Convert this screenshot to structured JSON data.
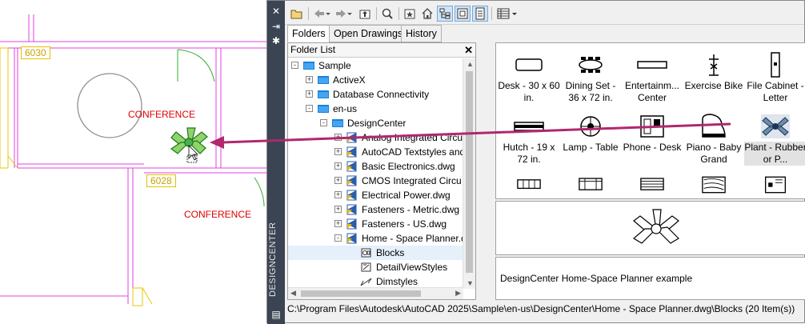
{
  "cad": {
    "rooms": [
      {
        "number": "6030",
        "label": "CONFERENCE"
      },
      {
        "number": "6028",
        "label": "CONFERENCE"
      }
    ]
  },
  "palette": {
    "title": "DESIGNCENTER",
    "strip_buttons": [
      "close-icon",
      "autohide-icon",
      "properties-icon"
    ]
  },
  "toolbar": {
    "buttons": [
      "load-icon",
      "back-icon",
      "forward-icon",
      "up-icon",
      "search-icon",
      "favorites-icon",
      "home-icon",
      "tree-toggle-icon",
      "preview-icon",
      "description-icon",
      "views-icon"
    ]
  },
  "tabs": [
    "Folders",
    "Open Drawings",
    "History"
  ],
  "folder_list": {
    "header": "Folder List",
    "items": [
      {
        "label": "Sample",
        "type": "folder"
      },
      {
        "label": "ActiveX",
        "type": "folder"
      },
      {
        "label": "Database Connectivity",
        "type": "folder"
      },
      {
        "label": "en-us",
        "type": "folder"
      },
      {
        "label": "DesignCenter",
        "type": "folder"
      },
      {
        "label": "Analog Integrated Circu",
        "type": "drawing"
      },
      {
        "label": "AutoCAD Textstyles and",
        "type": "drawing"
      },
      {
        "label": "Basic Electronics.dwg",
        "type": "drawing"
      },
      {
        "label": "CMOS Integrated Circu",
        "type": "drawing"
      },
      {
        "label": "Electrical Power.dwg",
        "type": "drawing"
      },
      {
        "label": "Fasteners - Metric.dwg",
        "type": "drawing"
      },
      {
        "label": "Fasteners - US.dwg",
        "type": "drawing"
      },
      {
        "label": "Home - Space Planner.d",
        "type": "drawing"
      },
      {
        "label": "Blocks",
        "type": "blocks"
      },
      {
        "label": "DetailViewStyles",
        "type": "styles"
      },
      {
        "label": "Dimstyles",
        "type": "dimstyles"
      }
    ]
  },
  "content": {
    "items": [
      {
        "label": "Desk - 30 x 60 in.",
        "icon": "desk-icon"
      },
      {
        "label": "Dining Set - 36 x 72 in.",
        "icon": "dining-set-icon"
      },
      {
        "label": "Entertainm... Center",
        "icon": "entertainment-center-icon"
      },
      {
        "label": "Exercise Bike",
        "icon": "exercise-bike-icon"
      },
      {
        "label": "File Cabinet - Letter",
        "icon": "file-cabinet-icon"
      },
      {
        "label": "Hutch - 19 x 72 in.",
        "icon": "hutch-icon"
      },
      {
        "label": "Lamp - Table",
        "icon": "lamp-icon"
      },
      {
        "label": "Phone - Desk",
        "icon": "phone-icon"
      },
      {
        "label": "Piano - Baby Grand",
        "icon": "piano-icon"
      },
      {
        "label": "Plant - Rubber or P...",
        "icon": "plant-icon",
        "selected": true
      }
    ]
  },
  "description": "DesignCenter Home-Space Planner example",
  "status": "C:\\Program Files\\Autodesk\\AutoCAD 2025\\Sample\\en-us\\DesignCenter\\Home - Space Planner.dwg\\Blocks (20 Item(s))",
  "colors": {
    "arrow": "#b0286e",
    "plan_lines": "#e040e0",
    "room_label": "#e00000"
  }
}
